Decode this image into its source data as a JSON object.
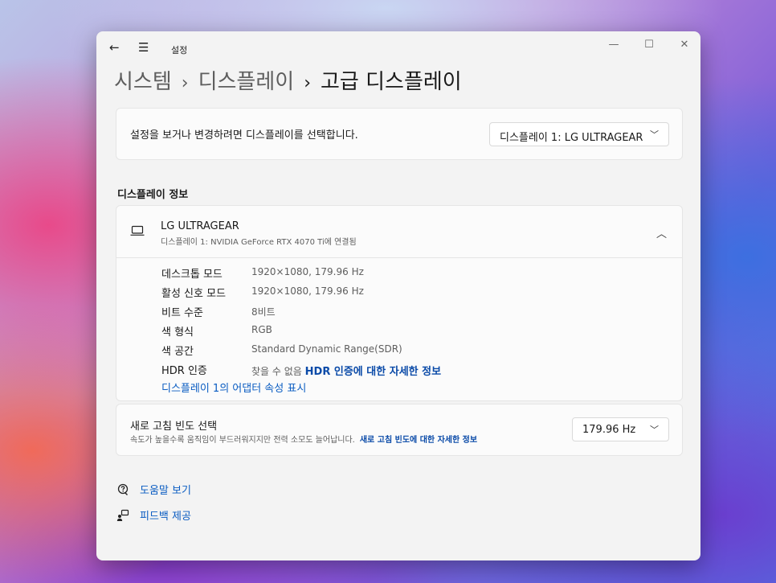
{
  "window": {
    "app_title": "설정",
    "back_icon": "←",
    "menu_icon": "☰",
    "min_icon": "—",
    "max_icon": "☐",
    "close_icon": "✕"
  },
  "breadcrumb": {
    "items": [
      "시스템",
      "디스플레이",
      "고급 디스플레이"
    ],
    "separator": "›"
  },
  "select_display": {
    "label": "설정을 보거나 변경하려면 디스플레이를 선택합니다.",
    "selected": "디스플레이 1: LG ULTRAGEAR"
  },
  "display_info": {
    "section_title": "디스플레이 정보",
    "monitor_name": "LG ULTRAGEAR",
    "monitor_sub": "디스플레이 1: NVIDIA GeForce RTX 4070 Ti에 연결됨",
    "rows": [
      {
        "key": "데스크톱 모드",
        "value": "1920×1080, 179.96 Hz"
      },
      {
        "key": "활성 신호 모드",
        "value": "1920×1080, 179.96 Hz"
      },
      {
        "key": "비트 수준",
        "value": "8비트"
      },
      {
        "key": "색 형식",
        "value": "RGB"
      },
      {
        "key": "색 공간",
        "value": "Standard Dynamic Range(SDR)"
      },
      {
        "key": "HDR 인증",
        "value": "찾을 수 없음",
        "link": "HDR 인증에 대한 자세한 정보"
      }
    ],
    "adapter_link": "디스플레이 1의 어댑터 속성 표시"
  },
  "refresh_rate": {
    "title": "새로 고침 빈도 선택",
    "description": "속도가 높을수록 움직임이 부드러워지지만 전력 소모도 늘어납니다.",
    "link": "새로 고침 빈도에 대한 자세한 정보",
    "selected": "179.96 Hz"
  },
  "help": {
    "get_help": "도움말 보기",
    "feedback": "피드백 제공"
  },
  "icons": {
    "chevron_down": "﹀",
    "chevron_up": "︿"
  }
}
